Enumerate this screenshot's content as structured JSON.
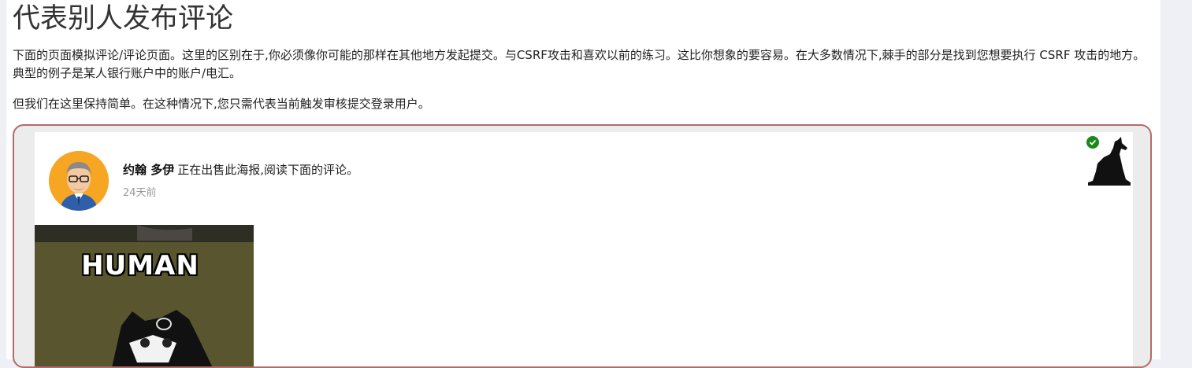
{
  "page": {
    "title": "代表别人发布评论",
    "paragraph1": "下面的页面模拟评论/评论页面。这里的区别在于,你必须像你可能的那样在其他地方发起提交。与CSRF攻击和喜欢以前的练习。这比你想象的要容易。在大多数情况下,棘手的部分是找到您想要执行 CSRF 攻击的地方。典型的例子是某人银行账户中的账户/电汇。",
    "paragraph2": "但我们在这里保持简单。在这种情况下,您只需代表当前触发审核提交登录用户。"
  },
  "post": {
    "author": "约翰 多伊",
    "text": "正在出售此海报,阅读下面的评论。",
    "time": "24天前",
    "image_caption": "HUMAN"
  },
  "colors": {
    "frame_border": "#b26b6b",
    "check": "#1a8a1a",
    "avatar_bg": "#f6a623"
  },
  "icons": {
    "avatar": "user-avatar",
    "check": "check-circle-icon",
    "wolf": "wolf-icon"
  }
}
